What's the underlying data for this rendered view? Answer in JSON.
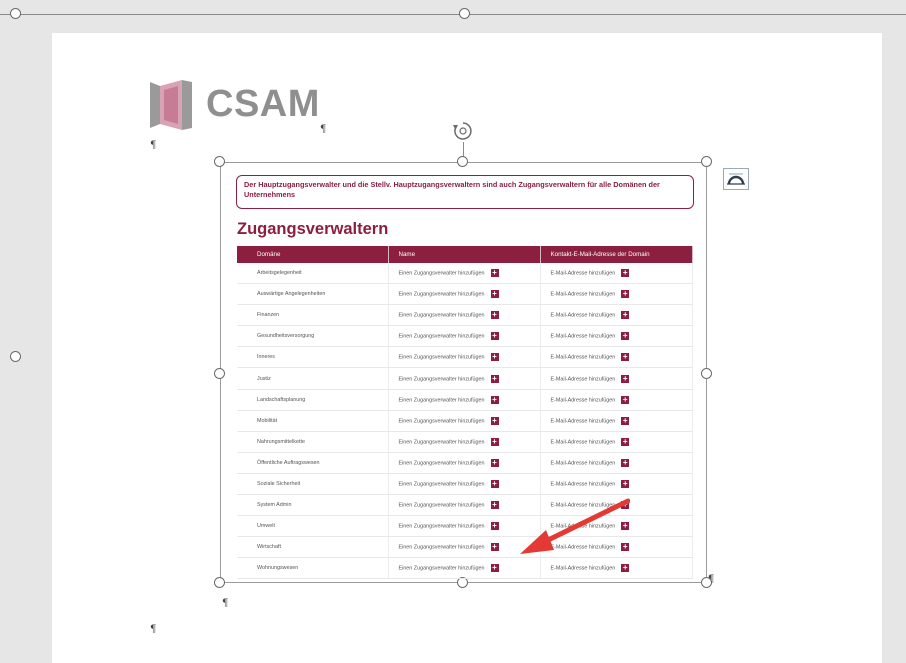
{
  "document": {
    "logo_text": "CSAM",
    "pilcrow": "¶"
  },
  "image": {
    "banner_text": "Der Hauptzugangsverwalter und die Stellv. Hauptzugangsverwaltern sind auch Zugangsverwaltern für alle Domänen der Unternehmens",
    "section_title": "Zugangsverwaltern",
    "table": {
      "headers": [
        "Domäne",
        "Name",
        "Kontakt-E-Mail-Adresse der Domain"
      ],
      "add_manager_label": "Einen Zugangsverwalter hinzufügen",
      "add_email_label": "E-Mail-Adresse hinzufügen",
      "rows": [
        "Arbeitsgelegenheit",
        "Auswärtige Angelegenheiten",
        "Finanzen",
        "Gesundheitsversorgung",
        "Inneres",
        "Justiz",
        "Landschaftsplanung",
        "Mobilität",
        "Nahrungsmittelkette",
        "Öffentliche Auftragswesen",
        "Soziale Sicherheit",
        "System Admin",
        "Umwelt",
        "Wirtschaft",
        "Wohnungswesen"
      ]
    }
  },
  "colors": {
    "accent": "#8c1f40",
    "arrow": "#e53935"
  },
  "icons": [
    "rotate-handle-icon",
    "layout-options-icon",
    "plus-icon",
    "arrow-annotation-icon"
  ]
}
